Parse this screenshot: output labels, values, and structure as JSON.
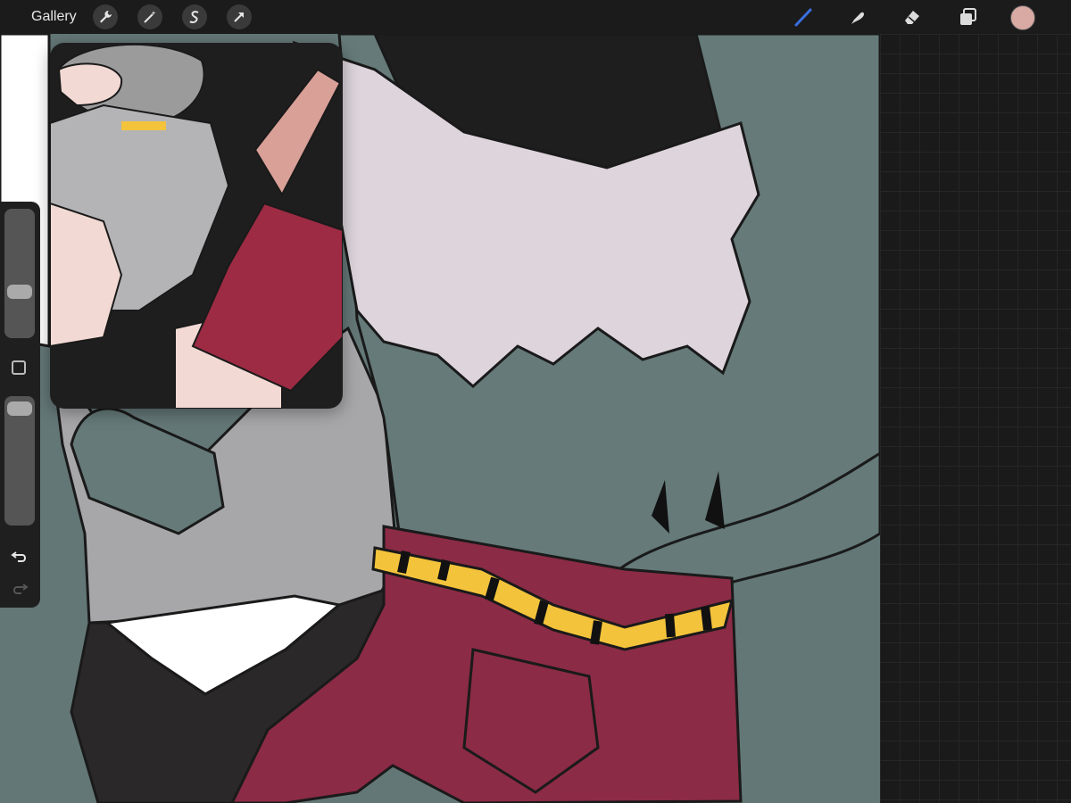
{
  "topbar": {
    "gallery_label": "Gallery",
    "left_tools": [
      "wrench-icon",
      "magic-wand-icon",
      "selection-icon",
      "transform-arrow-icon"
    ],
    "right_tools": [
      "brush-icon",
      "smudge-icon",
      "eraser-icon",
      "layers-icon"
    ],
    "active_tool": "brush-icon",
    "active_tool_color": "#3a6fe0",
    "current_color": "#d8aaa3"
  },
  "sidebar": {
    "brush_size_level": 0.34,
    "opacity_level": 0.95,
    "controls": [
      "brush-size-slider",
      "modify-button",
      "opacity-slider",
      "undo-icon",
      "redo-icon"
    ]
  },
  "canvas": {
    "background_color": "#647777",
    "colors": {
      "sweater_gray": "#a7a7a9",
      "wing_lavender": "#ddd4dc",
      "shorts_red": "#8b2b46",
      "belt_yellow": "#f3c33b",
      "dark_pants": "#2a2828",
      "skin_green": "#657a79"
    }
  },
  "reference_window": {
    "colors": {
      "sweater": "#b4b4b6",
      "background_dark": "#1f1e1f",
      "sleeve_red": "#9c2b43",
      "skin": "#f2d9d3",
      "hair": "#9b9b9b"
    }
  },
  "right_panel": {
    "background_color": "#1a1a1a",
    "grid_color": "#262626"
  }
}
